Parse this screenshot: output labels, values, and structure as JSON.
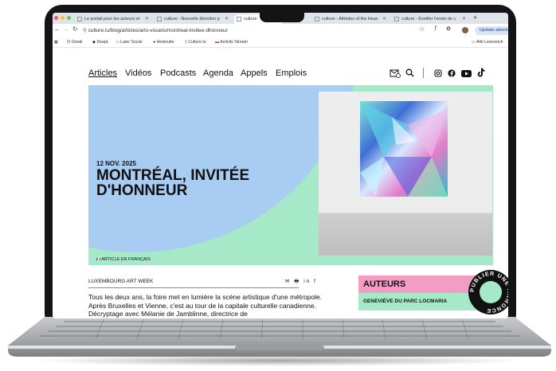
{
  "browser": {
    "tabs": [
      {
        "label": "Le portail pour les acteurs et"
      },
      {
        "label": "culture - Nouvelle direction p"
      },
      {
        "label": "culture"
      },
      {
        "label": "culture - Athletes of the Heav"
      },
      {
        "label": "culture - Éveiller l'envie de c"
      }
    ],
    "url": "culture.lu/blog/articles/arts-visuels/montreal-invitee-dhonneur",
    "update_label": "Update abschließe",
    "bookmarks": [
      "Gmail",
      "DeepL",
      "Later Social",
      "Hootsuite",
      "Culture.lu",
      "Activity Stream"
    ],
    "bookmarks_right": "Alle Lesezeich"
  },
  "nav": {
    "items": [
      "Articles",
      "Vidéos",
      "Podcasts",
      "Agenda",
      "Appels",
      "Emplois"
    ]
  },
  "hero": {
    "date": "12 NOV. 2025",
    "title": "MONTRÉAL, INVITÉE D'HONNEUR",
    "lang": "ARTICLE EN FRANÇAIS"
  },
  "article": {
    "category": "LUXEMBOURG ART WEEK",
    "share": "✉ 🖶 in f",
    "body": "Tous les deux ans, la foire met en lumière la scène artistique d'une métropole. Après Bruxelles et Vienne, c'est au tour de la capitale culturelle canadienne. Décryptage avec Mélanie de Jamblinne, directrice de"
  },
  "sidebar": {
    "auteurs_label": "AUTEURS",
    "author_name": "GENEVIÈVE DU PARC LOCMARIA",
    "annonce_badge": "PUBLIER UNE ANNONCE"
  },
  "colors": {
    "mint": "#a6e9c8",
    "sky": "#a9cdf2",
    "pink": "#f39dc5"
  }
}
